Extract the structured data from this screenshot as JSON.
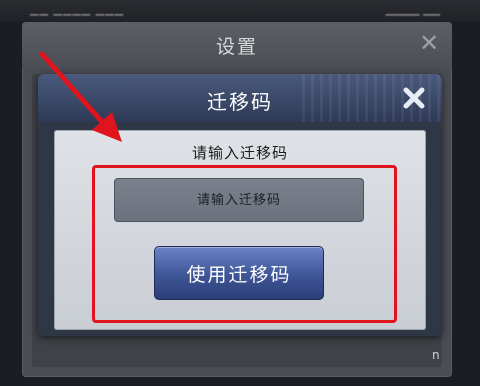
{
  "background_dialog": {
    "title": "设置",
    "trailing_letter": "n"
  },
  "dialog": {
    "title": "迁移码",
    "prompt": "请输入迁移码",
    "input": {
      "value": "",
      "placeholder": "请输入迁移码"
    },
    "use_button_label": "使用迁移码",
    "close_icon": "close-icon"
  },
  "colors": {
    "annotation_red": "#e0141c",
    "button_blue": "#3e5596",
    "header_blue": "#3a4868"
  }
}
